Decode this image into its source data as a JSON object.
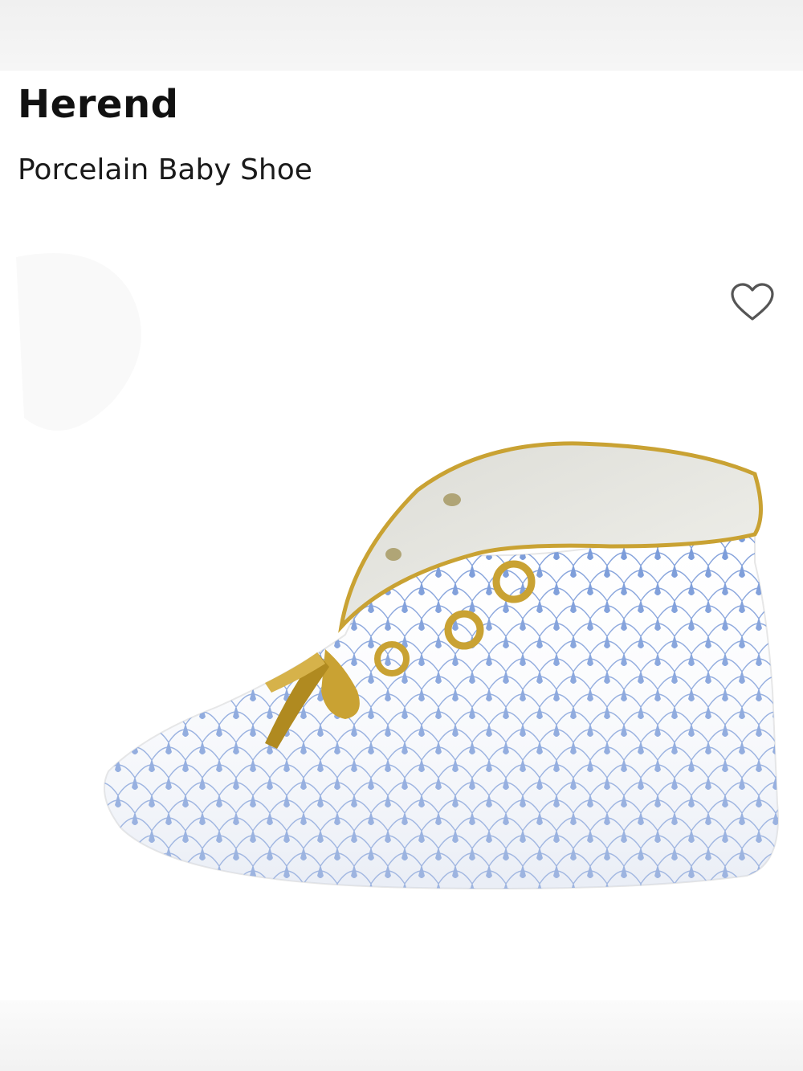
{
  "product": {
    "brand": "Herend",
    "name": "Porcelain Baby Shoe"
  },
  "image": {
    "subject": "porcelain-baby-shoe",
    "pattern_color": "#6f93d6",
    "trim_color": "#c9a233"
  },
  "actions": {
    "favorite_icon": "heart-outline-icon",
    "favorited": false
  }
}
